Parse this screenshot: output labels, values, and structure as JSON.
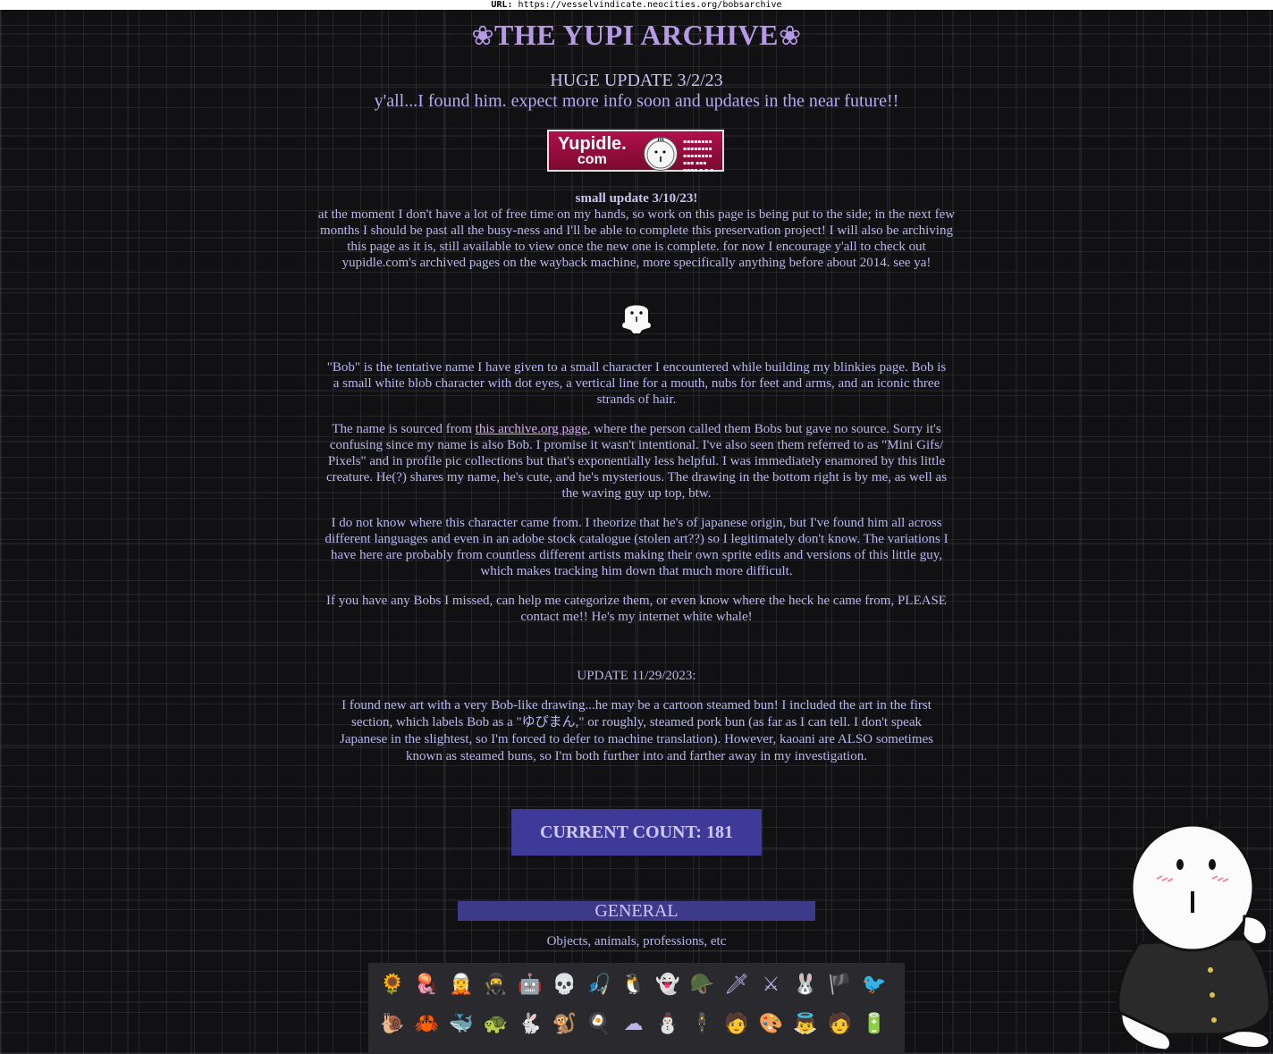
{
  "url_bar": {
    "label": "URL:",
    "url": "https://vesselvindicate.neocities.org/bobsarchive"
  },
  "header": {
    "flower_left": "❀",
    "title": "THE YUPI ARCHIVE",
    "flower_right": "❀"
  },
  "huge_update": {
    "line1": "HUGE UPDATE 3/2/23",
    "line2": "y'all...I found him. expect more info soon and updates in the near future!!"
  },
  "banner": {
    "word": "Yupidle.",
    "com": "com"
  },
  "small_update": {
    "heading": "small update 3/10/23!",
    "body": "at the moment I don't have a lot of free time on my hands, so work on this page is being put to the side; in the next few months I should be past all the busy-ness and I'll be able to complete this preservation project! I will also be archiving this page as it is, still available to view once the new one is complete. for now I encourage y'all to check out yupidle.com's archived pages on the wayback machine, more specifically anything before about 2014. see ya!"
  },
  "intro": {
    "p1": "\"Bob\" is the tentative name I have given to a small character I encountered while building my blinkies page. Bob is a small white blob character with dot eyes, a vertical line for a mouth, nubs for feet and arms, and an iconic three strands of hair.",
    "p2_before": "The name is sourced from ",
    "p2_link": "this archive.org page",
    "p2_after": ", where the person called them Bobs but gave no source. Sorry it's confusing since my name is also Bob. I promise it wasn't intentional. I've also seen them referred to as \"Mini Gifs/ Pixels\" and in profile pic collections but that's exponentially less helpful. I was immediately enamored by this little creature. He(?) shares my name, he's cute, and he's mysterious. The drawing in the bottom right is by me, as well as the waving guy up top, btw.",
    "p3": "I do not know where this character came from. I theorize that he's of japanese origin, but I've found him all across different languages and even in an adobe stock catalogue (stolen art??) so I legitimately don't know. The variations I have here are probably from countless different artists making their own sprite edits and versions of this little guy, which makes tracking him down that much more difficult.",
    "p4": "If you have any Bobs I missed, can help me categorize them, or even know where the heck he came from, PLEASE contact me!! He's my internet white whale!"
  },
  "update_1129": {
    "heading": "UPDATE 11/29/2023:",
    "body": "I found new art with a very Bob-like drawing...he may be a cartoon steamed bun! I included the art in the first section, which labels Bob as a \"ゆぴまん,\" or roughly, steamed pork bun (as far as I can tell. I don't speak Japanese in the slightest, so I'm forced to defer to machine translation). However, kaoani are ALSO sometimes known as steamed buns, so I'm both further into and farther away in my investigation."
  },
  "count": {
    "text": "CURRENT COUNT: 181"
  },
  "general": {
    "title": "GENERAL",
    "subtitle": "Objects, animals, professions, etc"
  },
  "gallery": {
    "icons": [
      {
        "name": "sunflower-bob-icon",
        "glyph": "🌻"
      },
      {
        "name": "jellyfish-bob-icon",
        "glyph": "🪼"
      },
      {
        "name": "elf-bob-icon",
        "glyph": "🧝"
      },
      {
        "name": "bandit-bob-icon",
        "glyph": "🥷"
      },
      {
        "name": "robot-bob-icon",
        "glyph": "🤖"
      },
      {
        "name": "skeleton-bob-icon",
        "glyph": "💀"
      },
      {
        "name": "fishing-bob-icon",
        "glyph": "🎣"
      },
      {
        "name": "penguin-bob-icon",
        "glyph": "🐧"
      },
      {
        "name": "ghost-bob-icon",
        "glyph": "👻"
      },
      {
        "name": "soldier-bob-icon",
        "glyph": "🪖"
      },
      {
        "name": "ninja-bob-icon",
        "glyph": "🗡"
      },
      {
        "name": "samurai-bob-icon",
        "glyph": "⚔"
      },
      {
        "name": "bunny-bob-icon",
        "glyph": "🐰"
      },
      {
        "name": "pirate-bob-icon",
        "glyph": "🏴"
      },
      {
        "name": "bird-bob-icon",
        "glyph": "🐦"
      },
      {
        "name": "snail-bob-icon",
        "glyph": "🐌"
      },
      {
        "name": "crab-bob-icon",
        "glyph": "🦀"
      },
      {
        "name": "whale-bob-icon",
        "glyph": "🐳"
      },
      {
        "name": "turtle-bob-icon",
        "glyph": "🐢"
      },
      {
        "name": "rabbit-ears-bob-icon",
        "glyph": "🐇"
      },
      {
        "name": "monkey-bob-icon",
        "glyph": "🐒"
      },
      {
        "name": "egg-bob-icon",
        "glyph": "🍳"
      },
      {
        "name": "blob-bob-icon",
        "glyph": "☁"
      },
      {
        "name": "snowman-bob-icon",
        "glyph": "⛄"
      },
      {
        "name": "suit-bob-icon",
        "glyph": "🕴"
      },
      {
        "name": "student-bob-icon",
        "glyph": "🧑"
      },
      {
        "name": "painter-bob-icon",
        "glyph": "🎨"
      },
      {
        "name": "angel-bob-icon",
        "glyph": "👼"
      },
      {
        "name": "nurse-bob-icon",
        "glyph": "🧑"
      },
      {
        "name": "battery-bob-icon",
        "glyph": "🔋"
      }
    ]
  }
}
